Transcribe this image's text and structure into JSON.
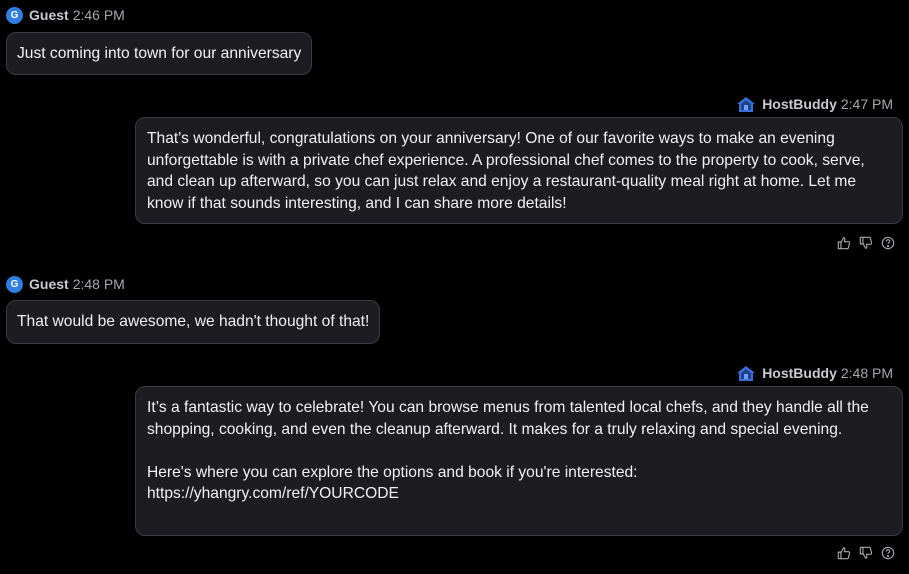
{
  "messages": [
    {
      "role": "guest",
      "avatar_letter": "G",
      "sender": "Guest",
      "time": "2:46 PM",
      "text": "Just coming into town for our anniversary"
    },
    {
      "role": "host",
      "sender": "HostBuddy",
      "time": "2:47 PM",
      "text": "That's wonderful, congratulations on your anniversary! One of our favorite ways to make an evening unforgettable is with a private chef experience. A professional chef comes to the property to cook, serve, and clean up afterward, so you can just relax and enjoy a restaurant-quality meal right at home. Let me know if that sounds interesting, and I can share more details!"
    },
    {
      "role": "guest",
      "avatar_letter": "G",
      "sender": "Guest",
      "time": "2:48 PM",
      "text": "That would be awesome, we hadn't thought of that!"
    },
    {
      "role": "host",
      "sender": "HostBuddy",
      "time": "2:48 PM",
      "text": "It’s a fantastic way to celebrate! You can browse menus from talented local chefs, and they handle all the shopping, cooking, and even the cleanup afterward. It makes for a truly relaxing and special evening.\n\nHere's where you can explore the options and book if you're interested:\nhttps://yhangry.com/ref/YOURCODE"
    }
  ],
  "colors": {
    "background": "#000000",
    "bubble": "#1c1c21",
    "bubble_border": "#3a3a42",
    "guest_avatar": "#2f7fe0",
    "host_logo": "#3b6fd8"
  },
  "icons": {
    "host_avatar": "house-logo-icon",
    "thumbs_up": "thumbs-up-icon",
    "thumbs_down": "thumbs-down-icon",
    "help": "question-circle-icon"
  }
}
